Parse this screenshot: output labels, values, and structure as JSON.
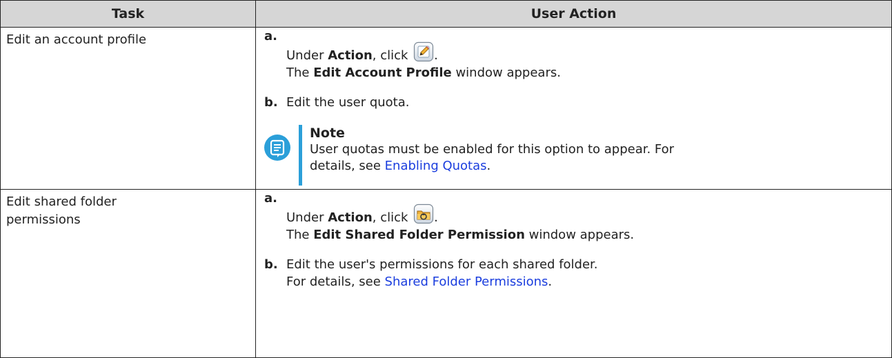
{
  "headers": {
    "task": "Task",
    "action": "User Action"
  },
  "rows": [
    {
      "task": "Edit an account profile",
      "step_a": {
        "marker": "a.",
        "pre": "Under ",
        "bold": "Action",
        "mid": ", click ",
        "icon": "edit-profile-icon",
        "end": ".",
        "line2_pre": "The ",
        "line2_bold": "Edit Account Profile",
        "line2_post": " window appears."
      },
      "step_b": {
        "marker": "b.",
        "text": "Edit the user quota."
      },
      "note": {
        "title": "Note",
        "line1": "User quotas must be enabled for this option to appear. For",
        "line2_pre": "details, see ",
        "link": "Enabling Quotas",
        "line2_post": "."
      }
    },
    {
      "task_line1": "Edit shared folder",
      "task_line2": "permissions",
      "step_a": {
        "marker": "a.",
        "pre": "Under ",
        "bold": "Action",
        "mid": ", click ",
        "icon": "shared-folder-permission-icon",
        "end": ".",
        "line2_pre": "The ",
        "line2_bold": "Edit Shared Folder Permission",
        "line2_post": " window appears."
      },
      "step_b": {
        "marker": "b.",
        "text": "Edit the user's permissions for each shared folder.",
        "line2_pre": "For details, see ",
        "link": "Shared Folder Permissions",
        "line2_post": "."
      }
    }
  ],
  "colors": {
    "header_bg": "#d6d6d6",
    "link": "#1a3dde",
    "note_accent": "#2b9fd9"
  }
}
